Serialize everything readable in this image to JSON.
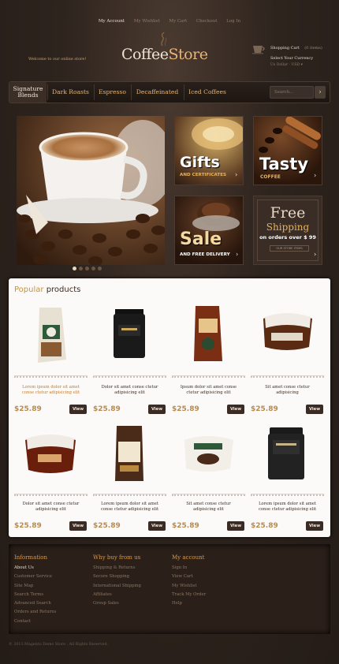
{
  "header": {
    "top_links": [
      "My Account",
      "My Wishlist",
      "My Cart",
      "Checkout",
      "Log In"
    ],
    "welcome": "Welcome to our online store!",
    "logo_part1": "Coffee",
    "logo_part2": "Store",
    "cart_label": "Shopping Cart",
    "cart_count": "(0 items)",
    "currency_label": "Select Your Currency",
    "currency_value": "Us Dollar - USD"
  },
  "nav": {
    "items": [
      "Signature Blends",
      "Dark Roasts",
      "Espresso",
      "Decaffeinated",
      "Iced Coffees"
    ],
    "search_placeholder": "Search..."
  },
  "banners": {
    "gifts_title": "Gifts",
    "gifts_sub": "AND CERTIFICATES",
    "tasty_title": "Tasty",
    "tasty_sub": "COFFEE",
    "sale_title": "Sale",
    "sale_sub": "AND FREE DELIVERY",
    "free_title": "Free",
    "free_sub": "Shipping",
    "free_line": "on orders over $ 99",
    "free_small": "OUR STORE ITEMS"
  },
  "products_title_a": "Popular",
  "products_title_b": "products",
  "view_label": "View",
  "products": [
    {
      "desc": "Lorem ipsum dolor sit amet conse ctetur adipisicing elit",
      "price": "$25.89"
    },
    {
      "desc": "Dolor sit amet conse ctetur adipisicing elit",
      "price": "$25.89"
    },
    {
      "desc": "Ipsum dolor sit amet conse ctetur adipisicing elit",
      "price": "$25.89"
    },
    {
      "desc": "Sit amet conse ctetur adipisicing",
      "price": "$25.89"
    },
    {
      "desc": "Dolor sit amet conse ctetur adipisicing elit",
      "price": "$25.89"
    },
    {
      "desc": "Lorem ipsum dolor sit amet conse ctetur adipisicing elit",
      "price": "$25.89"
    },
    {
      "desc": "Sit amet conse ctetur adipisicing elit",
      "price": "$25.89"
    },
    {
      "desc": "Lorem ipsum dolor sit amet conse ctetur adipisicing elit",
      "price": "$25.89"
    }
  ],
  "footer": {
    "info_title": "Information",
    "info_links": [
      "About Us",
      "Customer Service",
      "Site Map",
      "Search Terms",
      "Advanced Search",
      "Orders and Returns",
      "Contact"
    ],
    "why_title": "Why buy from us",
    "why_links": [
      "Shipping & Returns",
      "Secure Shopping",
      "International Shipping",
      "Affiliates",
      "Group Sales"
    ],
    "account_title": "My account",
    "account_links": [
      "Sign In",
      "View Cart",
      "My Wishlist",
      "Track My Order",
      "Help"
    ],
    "copyright": "© 2013 Magento Demo Store . All Rights Reserved."
  },
  "colors": {
    "accent": "#e6b574",
    "price": "#b98a4d",
    "dark": "#2b211c"
  }
}
